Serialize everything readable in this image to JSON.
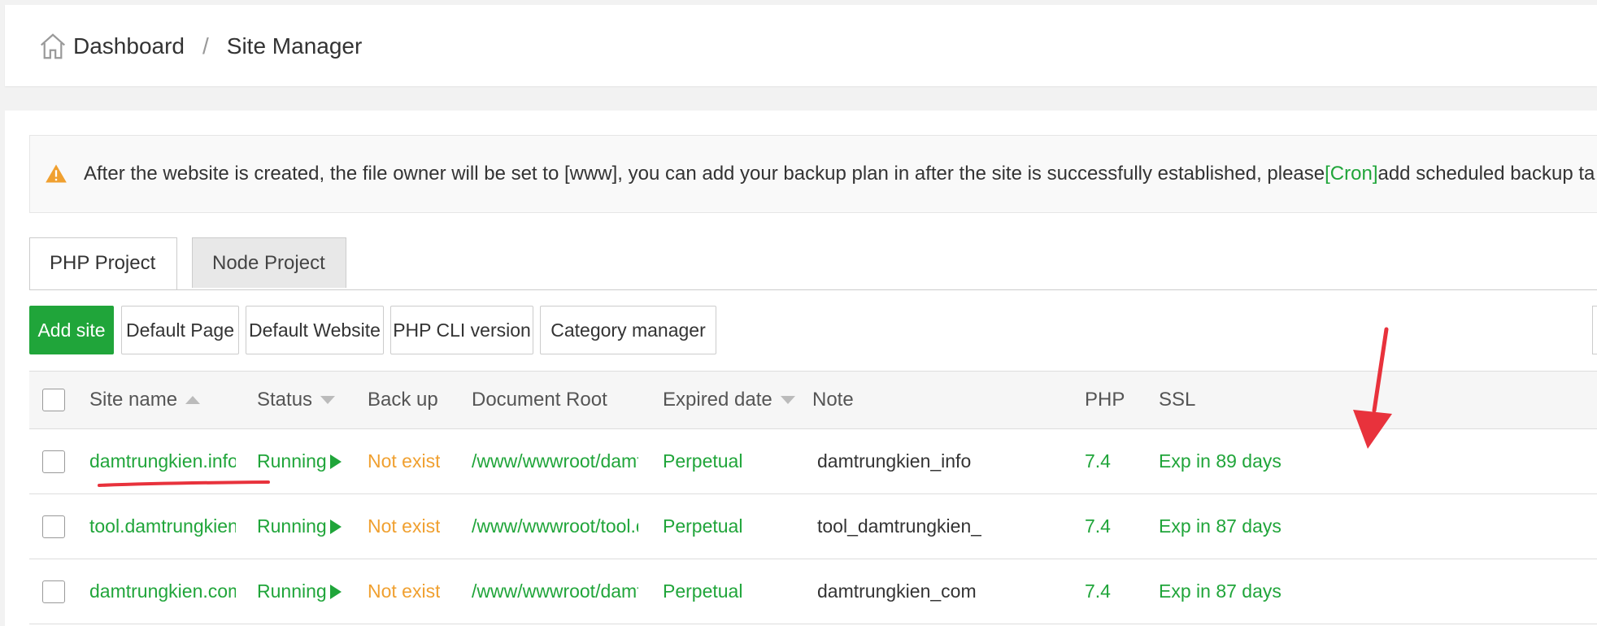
{
  "breadcrumb": {
    "home": "Dashboard",
    "separator": "/",
    "current": "Site Manager"
  },
  "alert": {
    "text_before": "After the website is created, the file owner will be set to [www], you can add your backup plan in after the site is successfully established, please",
    "link": "[Cron]",
    "text_after": "add scheduled backup ta"
  },
  "tabs": [
    {
      "label": "PHP Project"
    },
    {
      "label": "Node Project"
    }
  ],
  "toolbar": {
    "add_site": "Add site",
    "default_page": "Default Page",
    "default_website": "Default Website",
    "php_cli": "PHP CLI version",
    "category_manager": "Category manager"
  },
  "table": {
    "headers": {
      "site_name": "Site name",
      "status": "Status",
      "backup": "Back up",
      "document_root": "Document Root",
      "expired_date": "Expired date",
      "note": "Note",
      "php": "PHP",
      "ssl": "SSL"
    },
    "rows": [
      {
        "site_name": "damtrungkien.info",
        "status": "Running",
        "backup": "Not exist",
        "document_root": "/www/wwwroot/damtr…",
        "expired": "Perpetual",
        "note": "damtrungkien_info",
        "php": "7.4",
        "ssl": "Exp in 89 days"
      },
      {
        "site_name": "tool.damtrungkien…",
        "status": "Running",
        "backup": "Not exist",
        "document_root": "/www/wwwroot/tool.d…",
        "expired": "Perpetual",
        "note": "tool_damtrungkien_",
        "php": "7.4",
        "ssl": "Exp in 87 days"
      },
      {
        "site_name": "damtrungkien.com",
        "status": "Running",
        "backup": "Not exist",
        "document_root": "/www/wwwroot/damtr…",
        "expired": "Perpetual",
        "note": "damtrungkien_com",
        "php": "7.4",
        "ssl": "Exp in 87 days"
      }
    ]
  },
  "colors": {
    "accent_green": "#20a53a",
    "warning_orange": "#f0a030",
    "annotation_red": "#e8323c"
  }
}
